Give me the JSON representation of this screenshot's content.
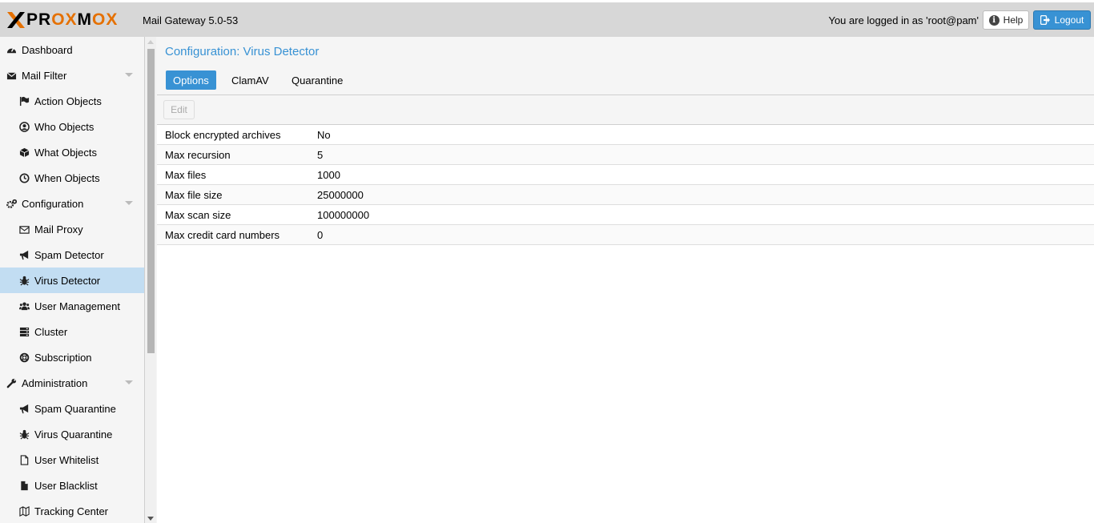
{
  "header": {
    "logo_text": "PROXMOX",
    "product": "Mail Gateway 5.0-53",
    "login_text": "You are logged in as 'root@pam'",
    "help_label": "Help",
    "logout_label": "Logout",
    "logout_color": "#3892d4",
    "logo_accent": "#e57000"
  },
  "sidebar": {
    "items": [
      {
        "label": "Dashboard",
        "icon": "dashboard-icon"
      },
      {
        "label": "Mail Filter",
        "icon": "envelope-icon"
      },
      {
        "label": "Action Objects",
        "icon": "flag-icon"
      },
      {
        "label": "Who Objects",
        "icon": "user-circle-icon"
      },
      {
        "label": "What Objects",
        "icon": "cube-icon"
      },
      {
        "label": "When Objects",
        "icon": "clock-icon"
      },
      {
        "label": "Configuration",
        "icon": "cogs-icon"
      },
      {
        "label": "Mail Proxy",
        "icon": "envelope-outline-icon"
      },
      {
        "label": "Spam Detector",
        "icon": "bullhorn-icon"
      },
      {
        "label": "Virus Detector",
        "icon": "bug-icon"
      },
      {
        "label": "User Management",
        "icon": "users-icon"
      },
      {
        "label": "Cluster",
        "icon": "server-icon"
      },
      {
        "label": "Subscription",
        "icon": "life-ring-icon"
      },
      {
        "label": "Administration",
        "icon": "wrench-icon"
      },
      {
        "label": "Spam Quarantine",
        "icon": "bullhorn-icon"
      },
      {
        "label": "Virus Quarantine",
        "icon": "bug-icon"
      },
      {
        "label": "User Whitelist",
        "icon": "file-outline-icon"
      },
      {
        "label": "User Blacklist",
        "icon": "file-icon"
      },
      {
        "label": "Tracking Center",
        "icon": "map-icon"
      }
    ],
    "active": "Virus Detector"
  },
  "main": {
    "title": "Configuration: Virus Detector",
    "tabs": [
      {
        "label": "Options"
      },
      {
        "label": "ClamAV"
      },
      {
        "label": "Quarantine"
      }
    ],
    "active_tab": "Options",
    "edit_label": "Edit",
    "rows": [
      {
        "key": "Block encrypted archives",
        "value": "No"
      },
      {
        "key": "Max recursion",
        "value": "5"
      },
      {
        "key": "Max files",
        "value": "1000"
      },
      {
        "key": "Max file size",
        "value": "25000000"
      },
      {
        "key": "Max scan size",
        "value": "100000000"
      },
      {
        "key": "Max credit card numbers",
        "value": "0"
      }
    ]
  }
}
